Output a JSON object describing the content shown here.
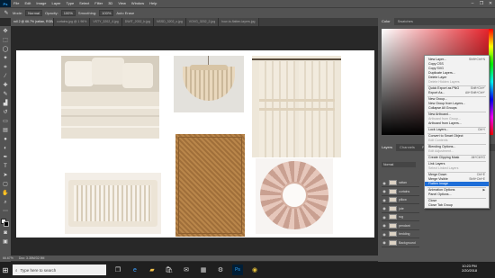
{
  "app": {
    "logo": "Ps"
  },
  "menubar": {
    "items": [
      "File",
      "Edit",
      "Image",
      "Layer",
      "Type",
      "Select",
      "Filter",
      "3D",
      "View",
      "Window",
      "Help"
    ],
    "window_controls": [
      "–",
      "❐",
      "✕"
    ]
  },
  "options": {
    "mode_label": "Mode:",
    "mode_value": "Normal",
    "opacity_label": "Opacity:",
    "opacity_value": "100%",
    "smoothing_label": "Smoothing:",
    "smoothing_value": "100%",
    "auto_erase": "Auto Erase"
  },
  "tabs": [
    "roll 2 @ 66.7% (rattan, RGB/8#) *",
    "curtains.jpg @ 1 96%",
    "VSTY_3202_4.jpg",
    "DWIT_2032_b.jpg",
    "NSSD_3202_c.jpg",
    "VOVG_3202_2.jpg",
    "how-to-flatten-layers.jpg"
  ],
  "statusbar": {
    "zoom": "66.67%",
    "doc": "Doc: 3.35M/32.9M"
  },
  "right_panel": {
    "top_tabs": [
      "Color",
      "Swatches"
    ],
    "layer_tabs": [
      "Layers",
      "Channels",
      "Paths"
    ],
    "blend": "Normal"
  },
  "layers": [
    {
      "name": "rattan"
    },
    {
      "name": "curtains"
    },
    {
      "name": "pillow"
    },
    {
      "name": "jute"
    },
    {
      "name": "rug"
    },
    {
      "name": "pendant"
    },
    {
      "name": "bedding"
    },
    {
      "name": "Background"
    }
  ],
  "context_menu": {
    "items": [
      {
        "label": "New Layer...",
        "shortcut": "Shift+Ctrl+N",
        "disabled": false,
        "highlight": false
      },
      {
        "label": "Copy CSS",
        "shortcut": "",
        "disabled": false,
        "highlight": false
      },
      {
        "label": "Copy SVG",
        "shortcut": "",
        "disabled": false,
        "highlight": false
      },
      {
        "label": "Duplicate Layers...",
        "shortcut": "",
        "disabled": false,
        "highlight": false
      },
      {
        "label": "Delete Layer",
        "shortcut": "",
        "disabled": false,
        "highlight": false
      },
      {
        "label": "Delete Hidden Layers",
        "shortcut": "",
        "disabled": true,
        "highlight": false
      },
      {
        "sep": true
      },
      {
        "label": "Quick Export as PNG",
        "shortcut": "Shift+Ctrl+'",
        "disabled": false,
        "highlight": false
      },
      {
        "label": "Export As...",
        "shortcut": "Alt+Shift+Ctrl+'",
        "disabled": false,
        "highlight": false
      },
      {
        "sep": true
      },
      {
        "label": "New Group...",
        "shortcut": "",
        "disabled": false,
        "highlight": false
      },
      {
        "label": "New Group from Layers...",
        "shortcut": "",
        "disabled": false,
        "highlight": false
      },
      {
        "label": "Collapse All Groups",
        "shortcut": "",
        "disabled": false,
        "highlight": false
      },
      {
        "sep": true
      },
      {
        "label": "New Artboard...",
        "shortcut": "",
        "disabled": false,
        "highlight": false
      },
      {
        "label": "Artboard from Group...",
        "shortcut": "",
        "disabled": true,
        "highlight": false
      },
      {
        "label": "Artboard from Layers...",
        "shortcut": "",
        "disabled": false,
        "highlight": false
      },
      {
        "sep": true
      },
      {
        "label": "Lock Layers...",
        "shortcut": "Ctrl+/",
        "disabled": false,
        "highlight": false
      },
      {
        "sep": true
      },
      {
        "label": "Convert to Smart Object",
        "shortcut": "",
        "disabled": false,
        "highlight": false
      },
      {
        "label": "Edit Contents",
        "shortcut": "",
        "disabled": true,
        "highlight": false
      },
      {
        "sep": true
      },
      {
        "label": "Blending Options...",
        "shortcut": "",
        "disabled": false,
        "highlight": false
      },
      {
        "label": "Edit Adjustment...",
        "shortcut": "",
        "disabled": true,
        "highlight": false
      },
      {
        "sep": true
      },
      {
        "label": "Create Clipping Mask",
        "shortcut": "Alt+Ctrl+G",
        "disabled": false,
        "highlight": false
      },
      {
        "sep": true
      },
      {
        "label": "Link Layers",
        "shortcut": "",
        "disabled": false,
        "highlight": false
      },
      {
        "label": "Select Linked Layers",
        "shortcut": "",
        "disabled": true,
        "highlight": false
      },
      {
        "sep": true
      },
      {
        "label": "Merge Down",
        "shortcut": "Ctrl+E",
        "disabled": false,
        "highlight": false
      },
      {
        "label": "Merge Visible",
        "shortcut": "Shift+Ctrl+E",
        "disabled": false,
        "highlight": false
      },
      {
        "label": "Flatten Image",
        "shortcut": "",
        "disabled": false,
        "highlight": true
      },
      {
        "sep": true
      },
      {
        "label": "Animation Options",
        "shortcut": "▶",
        "disabled": false,
        "highlight": false
      },
      {
        "label": "Panel Options...",
        "shortcut": "",
        "disabled": false,
        "highlight": false
      },
      {
        "sep": true
      },
      {
        "label": "Close",
        "shortcut": "",
        "disabled": false,
        "highlight": false
      },
      {
        "label": "Close Tab Group",
        "shortcut": "",
        "disabled": false,
        "highlight": false
      }
    ]
  },
  "taskbar": {
    "search_placeholder": "Type here to search",
    "time": "10:23 PM",
    "date": "2/20/2018"
  },
  "colors": {
    "accent": "#1e6ed8"
  }
}
